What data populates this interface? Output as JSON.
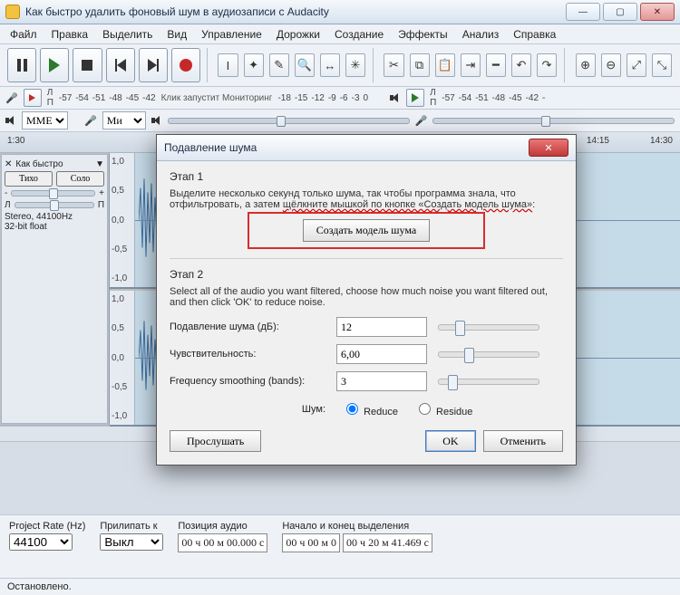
{
  "window": {
    "title": "Как быстро удалить фоновый шум в аудиозаписи с Audacity"
  },
  "menubar": [
    "Файл",
    "Правка",
    "Выделить",
    "Вид",
    "Управление",
    "Дорожки",
    "Создание",
    "Эффекты",
    "Анализ",
    "Справка"
  ],
  "transport": {
    "pause": "Пауза",
    "play": "Воспроизвести",
    "stop": "Стоп",
    "skip_start": "В начало",
    "skip_end": "В конец",
    "record": "Запись"
  },
  "meters": {
    "rec_ticks": [
      "-57",
      "-54",
      "-51",
      "-48",
      "-45",
      "-42"
    ],
    "rec_hint": "Клик запустит Мониторинг",
    "rec_ticks2": [
      "-18",
      "-15",
      "-12",
      "-9",
      "-6",
      "-3",
      "0"
    ],
    "play_ticks": [
      "-57",
      "-54",
      "-51",
      "-48",
      "-45",
      "-42",
      "-"
    ]
  },
  "device_row": {
    "host": "MME",
    "mic_label": "Ми"
  },
  "ruler": {
    "t1": "1:30",
    "t2": "14:15",
    "t3": "14:30"
  },
  "track": {
    "name": "Как быстро",
    "solo": "Соло",
    "mute": "Тихо",
    "pan_l": "Л",
    "pan_r": "П",
    "gain_neg": "-",
    "gain_pos": "+",
    "info1": "Stereo, 44100Hz",
    "info2": "32-bit float",
    "amp": [
      "1,0",
      "0,5",
      "0,0",
      "-0,5",
      "-1,0"
    ]
  },
  "bottom": {
    "rate_label": "Project Rate (Hz)",
    "rate": "44100",
    "snap_label": "Прилипать к",
    "snap": "Выкл",
    "pos_label": "Позиция аудио",
    "pos": "00 ч 00 м 00.000 с",
    "sel_label": "Начало и конец выделения",
    "sel1": "00 ч 00 м 0",
    "sel2": "00 ч 20 м 41.469 с"
  },
  "status": "Остановлено.",
  "dialog": {
    "title": "Подавление шума",
    "step1_h": "Этап 1",
    "step1_t1": "Выделите несколько секунд только шума, так чтобы программа знала, что отфильтровать, а затем ",
    "step1_strike": "щёлкните мышкой по кнопке «Создать модель шума»",
    "step1_t2": ":",
    "make_profile": "Создать модель шума",
    "step2_h": "Этап 2",
    "step2_t": "Select all of the audio you want filtered, choose how much noise you want filtered out, and then click 'OK' to reduce noise.",
    "f_reduce": "Подавление шума (дБ):",
    "v_reduce": "12",
    "f_sens": "Чувствительность:",
    "v_sens": "6,00",
    "f_smooth": "Frequency smoothing (bands):",
    "v_smooth": "3",
    "noise_lbl": "Шум:",
    "r_reduce": "Reduce",
    "r_residue": "Residue",
    "preview": "Прослушать",
    "ok": "OK",
    "cancel": "Отменить"
  }
}
